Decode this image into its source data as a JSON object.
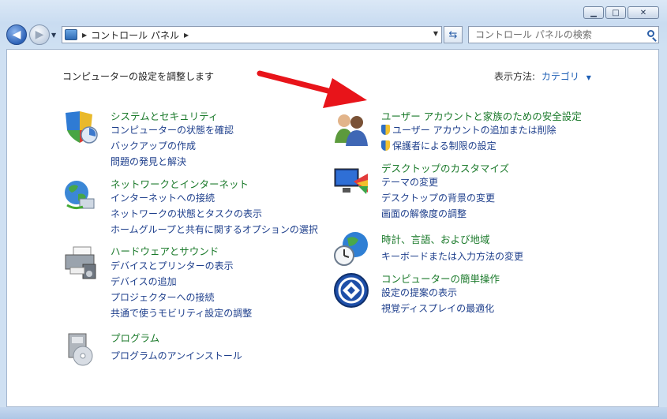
{
  "address": {
    "path_item": "コントロール パネル"
  },
  "search": {
    "placeholder": "コントロール パネルの検索"
  },
  "main": {
    "heading": "コンピューターの設定を調整します",
    "view_by_label": "表示方法:",
    "view_by_value": "カテゴリ"
  },
  "categories": {
    "system": {
      "title": "システムとセキュリティ",
      "links": [
        "コンピューターの状態を確認",
        "バックアップの作成",
        "問題の発見と解決"
      ]
    },
    "network": {
      "title": "ネットワークとインターネット",
      "links": [
        "インターネットへの接続",
        "ネットワークの状態とタスクの表示",
        "ホームグループと共有に関するオプションの選択"
      ]
    },
    "hardware": {
      "title": "ハードウェアとサウンド",
      "links": [
        "デバイスとプリンターの表示",
        "デバイスの追加",
        "プロジェクターへの接続",
        "共通で使うモビリティ設定の調整"
      ]
    },
    "programs": {
      "title": "プログラム",
      "links": [
        "プログラムのアンインストール"
      ]
    },
    "user_accounts": {
      "title": "ユーザー アカウントと家族のための安全設定",
      "links": [
        "ユーザー アカウントの追加または削除",
        "保護者による制限の設定"
      ]
    },
    "appearance": {
      "title": "デスクトップのカスタマイズ",
      "links": [
        "テーマの変更",
        "デスクトップの背景の変更",
        "画面の解像度の調整"
      ]
    },
    "clock": {
      "title": "時計、言語、および地域",
      "links": [
        "キーボードまたは入力方法の変更"
      ]
    },
    "ease": {
      "title": "コンピューターの簡単操作",
      "links": [
        "設定の提案の表示",
        "視覚ディスプレイの最適化"
      ]
    }
  },
  "colors": {
    "category_green": "#1b7a2b",
    "link_blue": "#1e3f8c",
    "annotation_arrow": "#e8141a"
  }
}
